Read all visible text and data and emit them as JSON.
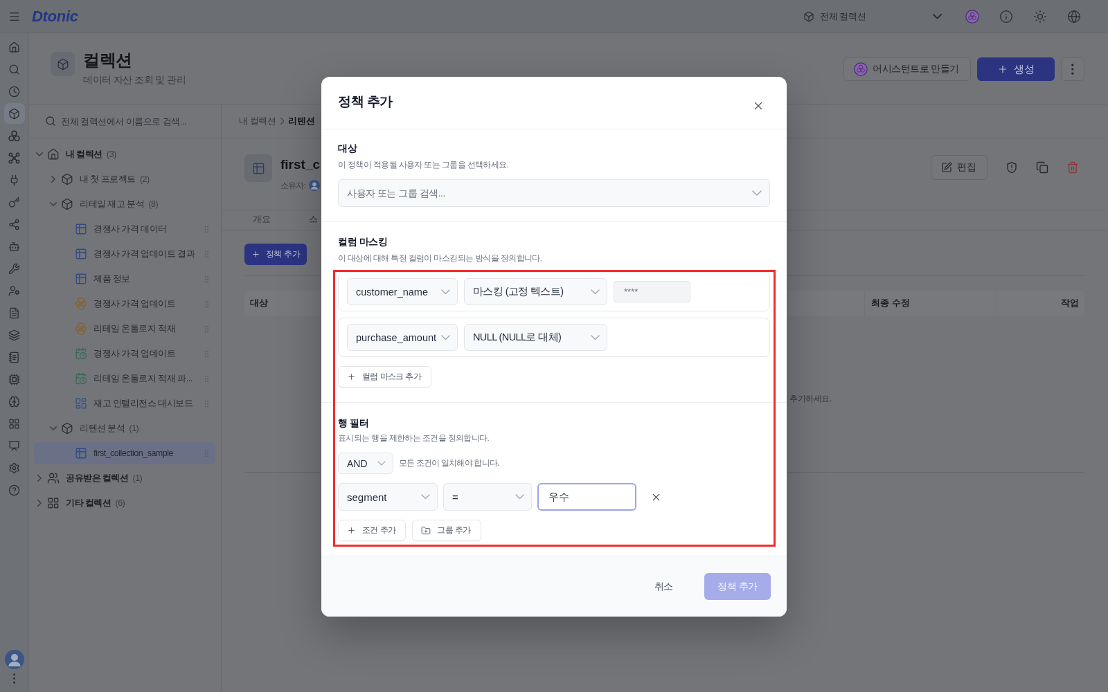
{
  "top_bar": {
    "logo": "Dtonic",
    "collection_selector": "전체 컬렉션"
  },
  "rail": [
    {
      "kind": "home",
      "selected": false
    },
    {
      "kind": "search",
      "selected": false
    },
    {
      "kind": "history",
      "selected": false
    },
    {
      "kind": "collections",
      "selected": true
    },
    {
      "kind": "models",
      "selected": false
    },
    {
      "kind": "ontology",
      "selected": false
    },
    {
      "kind": "pipeline",
      "selected": false
    },
    {
      "kind": "keys",
      "selected": false
    },
    {
      "kind": "lineage",
      "selected": false
    },
    {
      "kind": "agents",
      "selected": false
    },
    {
      "kind": "tools",
      "selected": false
    },
    {
      "kind": "users",
      "selected": false
    },
    {
      "kind": "docs",
      "selected": false
    },
    {
      "kind": "layers",
      "selected": false
    },
    {
      "kind": "notebook",
      "selected": false
    },
    {
      "kind": "compute",
      "selected": false
    },
    {
      "kind": "ai",
      "selected": false
    },
    {
      "kind": "apps",
      "selected": false
    },
    {
      "kind": "presentation",
      "selected": false
    },
    {
      "kind": "settings",
      "selected": false
    },
    {
      "kind": "help",
      "selected": false
    }
  ],
  "page_header": {
    "title": "컬렉션",
    "subtitle": "데이터 자산 조회 및 관리",
    "assistant_button": "어시스턴트로 만들기",
    "create_button": "생성"
  },
  "collection_panel": {
    "search_placeholder": "전체 컬렉션에서 이름으로 검색...",
    "tree": [
      {
        "kind": "home",
        "label": "내 컬렉션",
        "count": "(3)",
        "expanded": true,
        "children": [
          {
            "kind": "project",
            "label": "내 첫 프로젝트",
            "count": "(2)",
            "expanded": false
          },
          {
            "kind": "project",
            "label": "리테일 재고 분석",
            "count": "(8)",
            "expanded": true,
            "children": [
              {
                "kind": "table",
                "label": "경쟁사 가격 데이터",
                "selected": false
              },
              {
                "kind": "table",
                "label": "경쟁사 가격 업데이트 결과",
                "selected": false
              },
              {
                "kind": "table",
                "label": "제품 정보",
                "selected": false
              },
              {
                "kind": "python",
                "label": "경쟁사 가격 업데이트",
                "selected": false
              },
              {
                "kind": "python",
                "label": "리테일 온톨로지 적재",
                "selected": false
              },
              {
                "kind": "schedule",
                "label": "경쟁사 가격 업데이트",
                "selected": false
              },
              {
                "kind": "schedule",
                "label": "리테일 온톨로지 적재 파...",
                "selected": false
              },
              {
                "kind": "dashboard",
                "label": "재고 인텔리전스 대시보드",
                "selected": false
              }
            ]
          },
          {
            "kind": "project",
            "label": "리텐션 분석",
            "count": "(1)",
            "expanded": true,
            "children": [
              {
                "kind": "table",
                "label": "first_collection_sample",
                "selected": true
              }
            ]
          }
        ]
      },
      {
        "kind": "shared",
        "label": "공유받은 컬렉션",
        "count": "(1)",
        "expanded": false
      },
      {
        "kind": "other",
        "label": "기타 컬렉션",
        "count": "(6)",
        "expanded": false
      }
    ]
  },
  "detail": {
    "breadcrumb": [
      "내 컬렉션",
      "리텐션"
    ],
    "title": "first_c",
    "owner_label": "소유자:",
    "edit_button": "편집",
    "tabs": [
      {
        "label": "개요",
        "selected": false
      },
      {
        "label": "스",
        "selected": false
      }
    ],
    "add_policy_button": "정책 추가",
    "table": {
      "columns": [
        "대상",
        "최종 수정",
        "작업"
      ],
      "empty_text": "추가하세요."
    }
  },
  "dialog": {
    "title": "정책 추가",
    "highlight": true,
    "target": {
      "title": "대상",
      "description": "이 정책이 적용될 사용자 또는 그룹을 선택하세요.",
      "placeholder": "사용자 또는 그룹 검색..."
    },
    "masking": {
      "title": "컬럼 마스킹",
      "description": "이 대상에 대해 특정 컬럼이 마스킹되는 방식을 정의합니다.",
      "masks": [
        {
          "kind": "fixed",
          "column": "customer_name",
          "method": "마스킹 (고정 텍스트)",
          "value": "****"
        },
        {
          "kind": "null",
          "column": "purchase_amount",
          "method": "NULL (NULL로 대체)"
        }
      ],
      "add_button": "컬럼 마스크 추가"
    },
    "row_filter": {
      "title": "행 필터",
      "description": "표시되는 행을 제한하는 조건을 정의합니다.",
      "logic": "AND",
      "logic_hint": "모든 조건이 일치해야 합니다.",
      "conditions": [
        {
          "column": "segment",
          "operator": "=",
          "value": "우수",
          "focused": true
        }
      ],
      "buttons": [
        {
          "kind": "condition",
          "label": "조건 추가"
        },
        {
          "kind": "group",
          "label": "그룹 추가"
        }
      ]
    },
    "footer": {
      "cancel": "취소",
      "submit": {
        "label": "정책 추가",
        "disabled": true
      }
    }
  }
}
